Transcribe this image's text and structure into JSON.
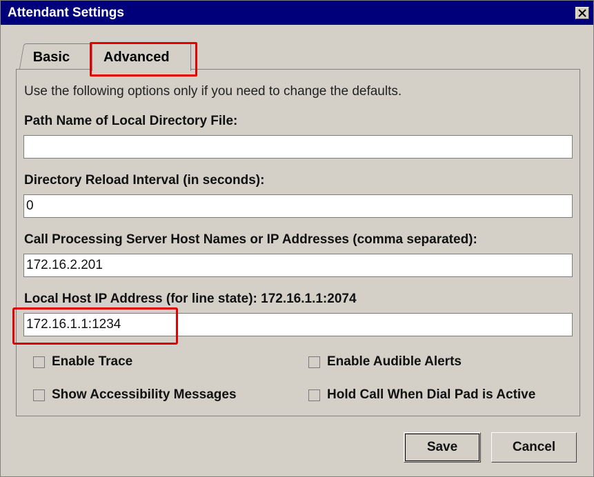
{
  "window": {
    "title": "Attendant Settings"
  },
  "tabs": [
    {
      "label": "Basic"
    },
    {
      "label": "Advanced"
    }
  ],
  "advanced": {
    "description": "Use the following options only if you need to change the defaults.",
    "fields": [
      {
        "label": "Path Name of Local Directory File:",
        "value": ""
      },
      {
        "label": "Directory Reload Interval (in seconds):",
        "value": "0"
      },
      {
        "label": "Call Processing Server Host Names or IP Addresses (comma separated):",
        "value": "172.16.2.201"
      },
      {
        "label": "Local Host IP Address (for line state):  172.16.1.1:2074",
        "value": "172.16.1.1:1234"
      }
    ],
    "checkboxes": [
      {
        "label": "Enable Trace",
        "checked": false
      },
      {
        "label": "Enable Audible Alerts",
        "checked": false
      },
      {
        "label": "Show Accessibility Messages",
        "checked": false
      },
      {
        "label": "Hold Call When Dial Pad is Active",
        "checked": false
      }
    ]
  },
  "buttons": {
    "save": "Save",
    "cancel": "Cancel"
  },
  "icons": {
    "close": "close-icon"
  },
  "colors": {
    "titlebar": "#00007a",
    "highlight": "#e00000",
    "background": "#d4d0c8"
  }
}
